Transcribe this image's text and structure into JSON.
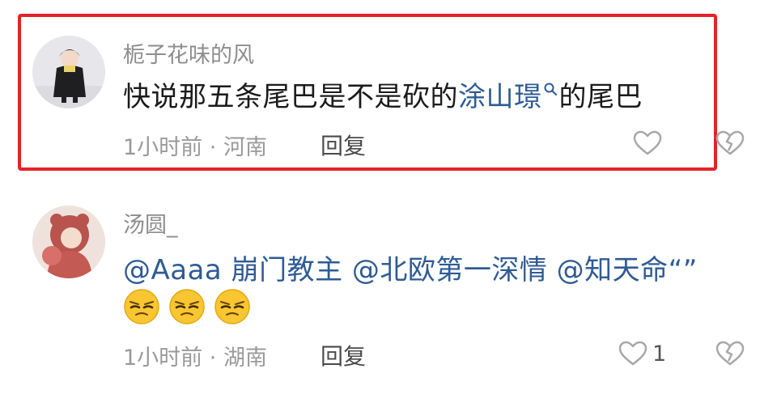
{
  "comments": [
    {
      "username": "栀子花味的风",
      "content_before": "快说那五条尾巴是不是砍的",
      "content_link": "涂山璟",
      "content_after": "的尾巴",
      "time": "1小时前",
      "separator": "·",
      "location": "河南",
      "reply_label": "回复",
      "like_count": "",
      "highlighted": true
    },
    {
      "username": "汤圆_",
      "mentions": "@Aaaa 崩门教主 @北欧第一深情 @知天命“”",
      "emojis": [
        "squint-face-emoji",
        "squint-face-emoji",
        "squint-face-emoji"
      ],
      "time": "1小时前",
      "separator": "·",
      "location": "湖南",
      "reply_label": "回复",
      "like_count": "1"
    }
  ],
  "colors": {
    "highlight_border": "#e6212a",
    "link": "#2f5b94",
    "username": "#8d8d8d",
    "meta": "#9a9a9a"
  },
  "icons": [
    "search-icon",
    "heart-icon",
    "broken-heart-icon"
  ]
}
